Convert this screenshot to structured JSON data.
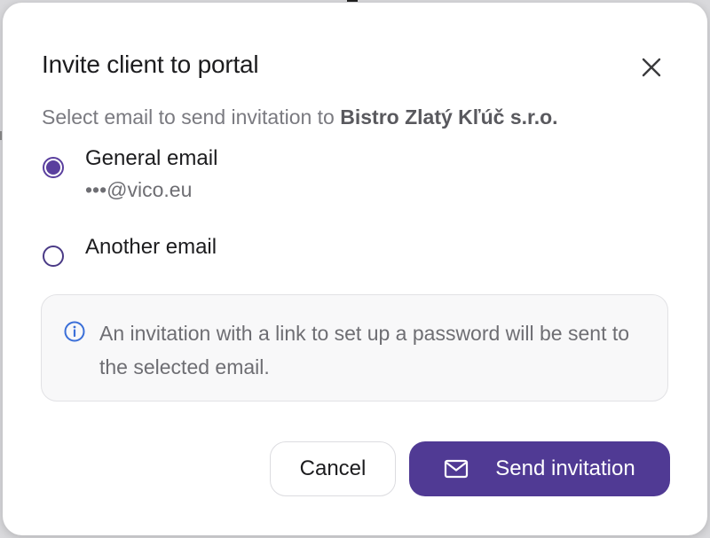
{
  "dialog": {
    "title": "Invite client to portal",
    "close_icon": "close-icon",
    "subtitle_prefix": "Select email to send invitation to ",
    "client_name": "Bistro Zlatý Kľúč s.r.o."
  },
  "options": [
    {
      "label": "General email",
      "value": "•••@vico.eu",
      "selected": true
    },
    {
      "label": "Another email",
      "selected": false
    }
  ],
  "info": {
    "icon": "info-icon",
    "text": "An invitation with a link to set up a password will be sent to the selected email."
  },
  "buttons": {
    "cancel_label": "Cancel",
    "send_label": "Send invitation",
    "send_icon": "mail-icon"
  },
  "colors": {
    "accent": "#503a94",
    "radio_selected": "#5a3f9e",
    "info_icon": "#3b6fd8"
  }
}
